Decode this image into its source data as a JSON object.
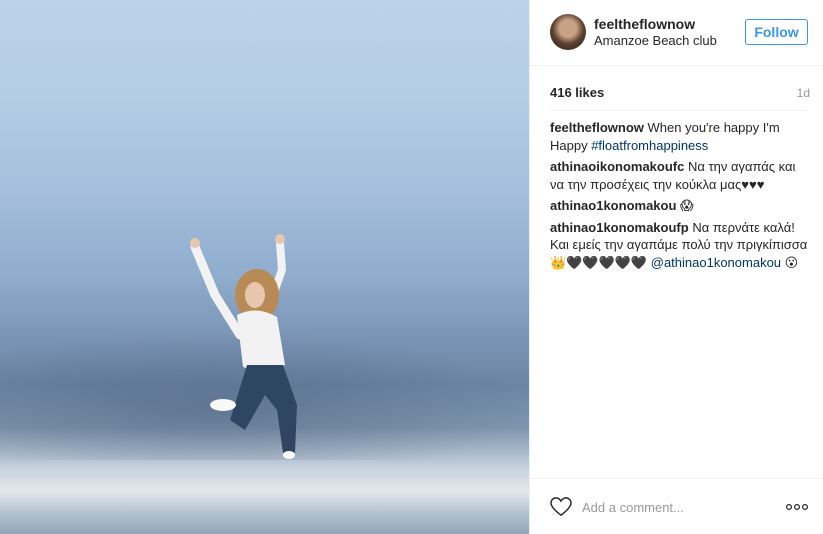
{
  "post": {
    "username": "feeltheflownow",
    "location": "Amanzoe Beach club",
    "follow_label": "Follow",
    "likes": "416 likes",
    "age": "1d"
  },
  "comments": [
    {
      "author": "feeltheflownow",
      "text": "When you're happy I'm Happy",
      "tag": "#floatfromhappiness"
    },
    {
      "author": "athinaoikonomakoufc",
      "text": "Να την αγαπάς και να την προσέχεις την κούκλα μας♥♥♥"
    },
    {
      "author": "athinao1konomakou",
      "text": "😱"
    },
    {
      "author": "athinao1konomakoufp",
      "text": "Να περνάτε καλά! Και εμείς την αγαπάμε πολύ την πριγκίπισσα 👑🖤🖤🖤🖤🖤",
      "mention": "@athinao1konomakou",
      "after": "😮"
    }
  ],
  "footer": {
    "placeholder": "Add a comment..."
  },
  "icons": {
    "heart": "heart-icon",
    "more": "more-options-icon"
  },
  "colors": {
    "accent": "#3897f0",
    "hashtag": "#003569",
    "muted": "#999999"
  }
}
